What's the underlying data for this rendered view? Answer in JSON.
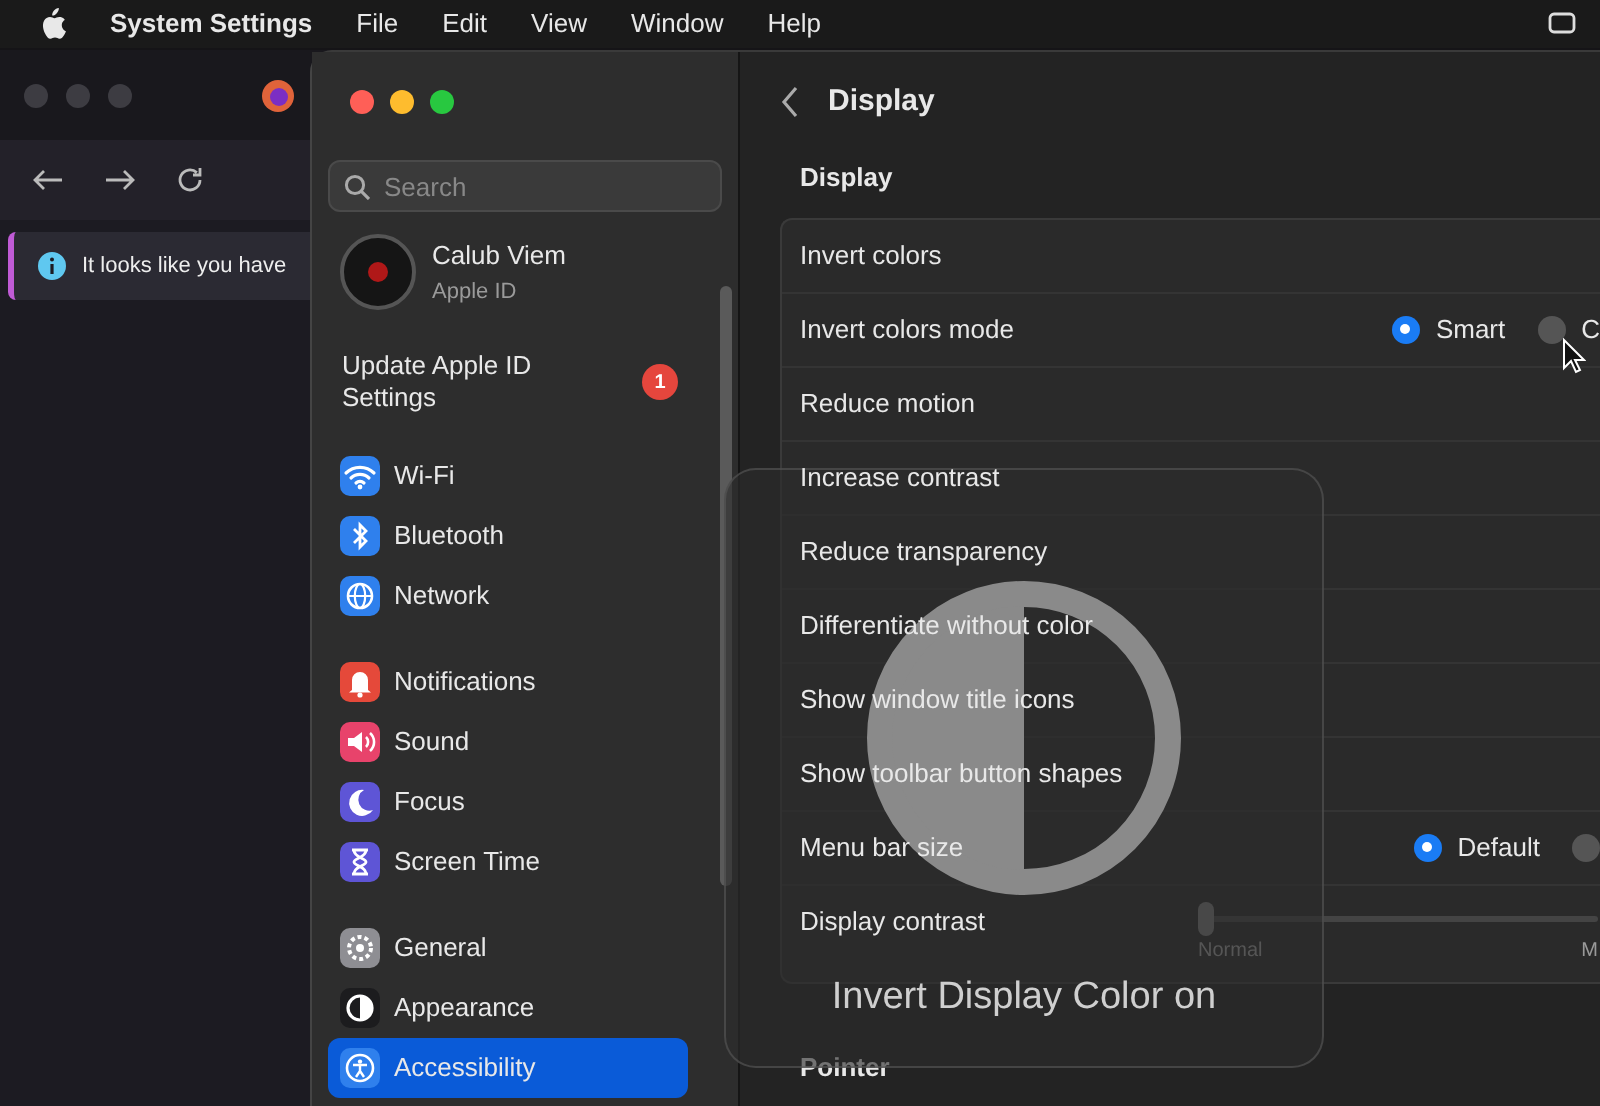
{
  "menu_bar": {
    "app": "System Settings",
    "menus": [
      "File",
      "Edit",
      "View",
      "Window",
      "Help"
    ]
  },
  "browser_window": {
    "notice": "It looks like you have"
  },
  "settings_window": {
    "search": {
      "placeholder": "Search"
    },
    "account": {
      "name": "Calub Viem",
      "subtitle": "Apple ID"
    },
    "alert": {
      "label": "Update Apple ID Settings",
      "badge": "1"
    },
    "sidebar": {
      "groups": [
        {
          "items": [
            {
              "label": "Wi-Fi",
              "color": "#2f80ed",
              "selected": false
            },
            {
              "label": "Bluetooth",
              "color": "#2f80ed",
              "selected": false
            },
            {
              "label": "Network",
              "color": "#2f80ed",
              "selected": false
            }
          ]
        },
        {
          "items": [
            {
              "label": "Notifications",
              "color": "#e5493a",
              "selected": false
            },
            {
              "label": "Sound",
              "color": "#e8436b",
              "selected": false
            },
            {
              "label": "Focus",
              "color": "#5e55d6",
              "selected": false
            },
            {
              "label": "Screen Time",
              "color": "#5e55d6",
              "selected": false
            }
          ]
        },
        {
          "items": [
            {
              "label": "General",
              "color": "#8e8e93",
              "selected": false
            },
            {
              "label": "Appearance",
              "color": "#1c1c1e",
              "selected": false
            },
            {
              "label": "Accessibility",
              "color": "#2f80ed",
              "selected": true
            }
          ]
        }
      ]
    },
    "page_title": "Display",
    "section": "Display",
    "rows": [
      {
        "kind": "plain",
        "label": "Invert colors"
      },
      {
        "kind": "radio",
        "label": "Invert colors mode",
        "options": [
          {
            "label": "Smart",
            "selected": true
          },
          {
            "label": "C",
            "selected": false
          }
        ]
      },
      {
        "kind": "plain",
        "label": "Reduce motion"
      },
      {
        "kind": "plain",
        "label": "Increase contrast"
      },
      {
        "kind": "plain",
        "label": "Reduce transparency"
      },
      {
        "kind": "plain",
        "label": "Differentiate without color"
      },
      {
        "kind": "plain",
        "label": "Show window title icons"
      },
      {
        "kind": "plain",
        "label": "Show toolbar button shapes"
      },
      {
        "kind": "radio",
        "label": "Menu bar size",
        "options": [
          {
            "label": "Default",
            "selected": true
          },
          {
            "selected": false
          }
        ]
      },
      {
        "kind": "slider",
        "label": "Display contrast",
        "level": 0,
        "min_label": "Normal",
        "max_label": "M"
      }
    ],
    "next_section": "Pointer"
  },
  "hud": {
    "message": "Invert Display Color on"
  }
}
